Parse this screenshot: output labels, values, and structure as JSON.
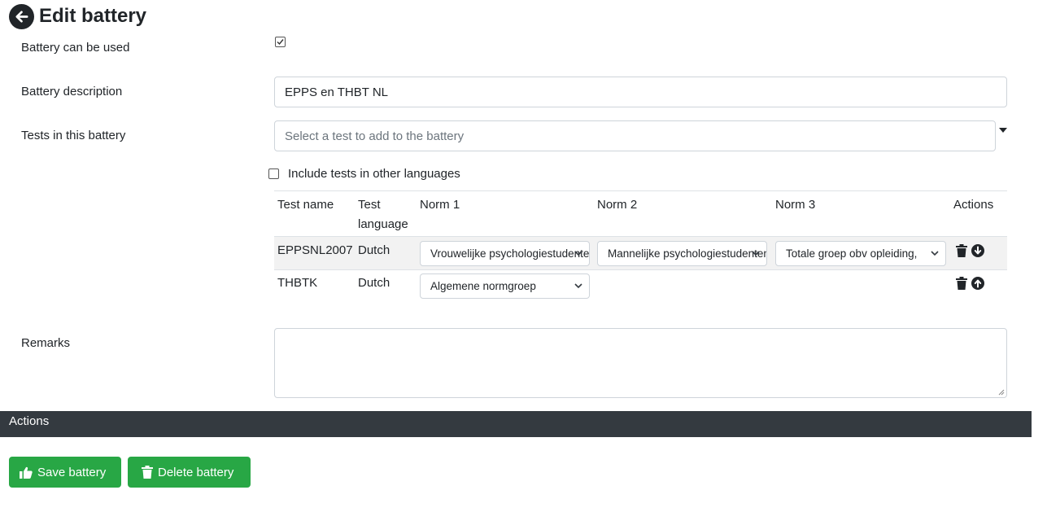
{
  "header": {
    "title": "Edit battery",
    "back_icon": "arrow-left-circle-icon"
  },
  "form": {
    "usable_label": "Battery can be used",
    "usable_checked": true,
    "description_label": "Battery description",
    "description_value": "EPPS en THBT NL",
    "tests_label": "Tests in this battery",
    "tests_placeholder": "Select a test to add to the battery",
    "include_other_languages_label": "Include tests in other languages",
    "include_other_languages_checked": false,
    "remarks_label": "Remarks",
    "remarks_value": ""
  },
  "table": {
    "headers": {
      "test_name": "Test name",
      "test_language_1": "Test",
      "test_language_2": "language",
      "norm1": "Norm 1",
      "norm2": "Norm 2",
      "norm3": "Norm 3",
      "actions": "Actions"
    },
    "rows": [
      {
        "name": "EPPSNL2007",
        "language": "Dutch",
        "norm1": "Vrouwelijke psychologiestudenten",
        "norm2": "Mannelijke psychologiestudenten",
        "norm3": "Totale groep obv opleiding, ",
        "icons": [
          "trash-icon",
          "arrow-down-circle-icon"
        ]
      },
      {
        "name": "THBTK",
        "language": "Dutch",
        "norm1": "Algemene normgroep",
        "icons": [
          "trash-icon",
          "arrow-up-circle-icon"
        ]
      }
    ]
  },
  "actions": {
    "title": "Actions",
    "save_label": "Save battery",
    "save_icon": "thumbs-up-icon",
    "delete_label": "Delete battery",
    "delete_icon": "trash-icon"
  },
  "colors": {
    "primary_button": "#28a745",
    "actions_bar": "#343a40",
    "stripe": "#f2f2f2"
  }
}
